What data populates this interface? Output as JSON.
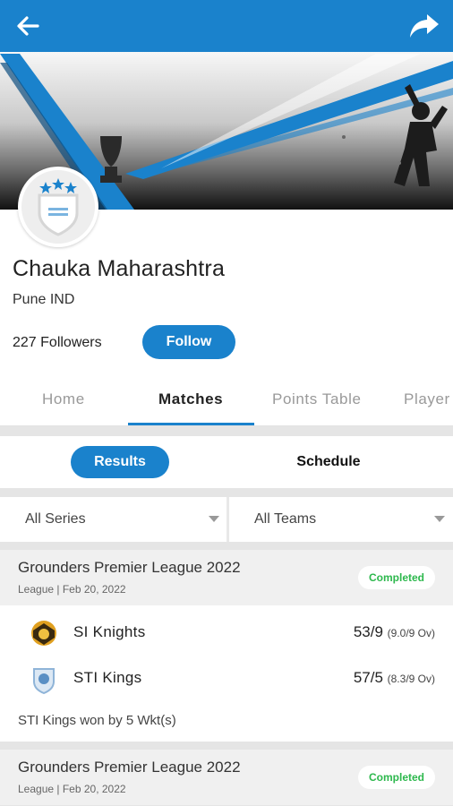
{
  "header": {
    "back_icon": "arrow-left-icon",
    "share_icon": "share-arrow-icon",
    "color": "#1a82cc"
  },
  "team": {
    "name": "Chauka Maharashtra",
    "location": "Pune IND",
    "followers": "227 Followers",
    "follow_label": "Follow"
  },
  "tabs": [
    {
      "label": "Home"
    },
    {
      "label": "Matches"
    },
    {
      "label": "Points Table"
    },
    {
      "label": "Player"
    }
  ],
  "toggle": {
    "results_label": "Results",
    "schedule_label": "Schedule"
  },
  "filters": {
    "series": "All Series",
    "teams": "All Teams"
  },
  "matches": [
    {
      "title": "Grounders Premier League 2022",
      "subtitle": "League | Feb 20, 2022",
      "status": "Completed",
      "team1": {
        "name": "SI Knights",
        "score": "53/9",
        "overs": "(9.0/9 Ov)"
      },
      "team2": {
        "name": "STI Kings",
        "score": "57/5",
        "overs": "(8.3/9 Ov)"
      },
      "result": "STI Kings won by 5 Wkt(s)"
    },
    {
      "title": "Grounders Premier League 2022",
      "subtitle": "League | Feb 20, 2022",
      "status": "Completed"
    }
  ]
}
